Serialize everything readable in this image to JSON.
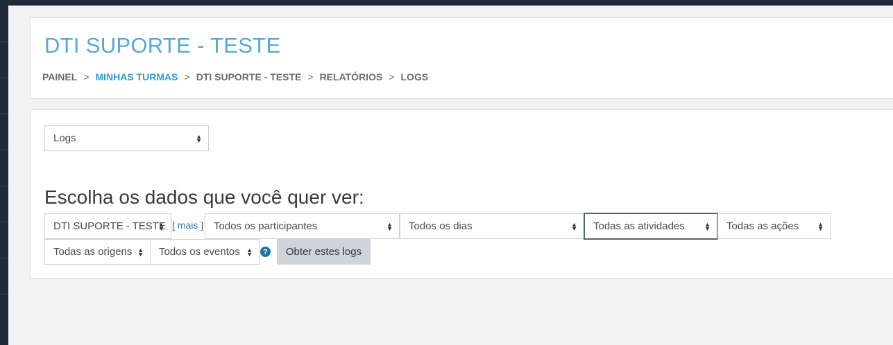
{
  "course": {
    "title": "DTI SUPORTE - TESTE"
  },
  "breadcrumb": [
    {
      "label": "PAINEL",
      "link": false
    },
    {
      "label": "MINHAS TURMAS",
      "link": true
    },
    {
      "label": "DTI SUPORTE - TESTE",
      "link": false
    },
    {
      "label": "RELATÓRIOS",
      "link": false
    },
    {
      "label": "LOGS",
      "link": false
    }
  ],
  "breadcrumb_separator": ">",
  "report_selector": {
    "value": "Logs"
  },
  "filters": {
    "heading": "Escolha os dados que você quer ver:",
    "course_select": "DTI SUPORTE - TESTE",
    "more_link_open": "[",
    "more_link": "mais",
    "more_link_close": "]",
    "participants_select": "Todos os participantes",
    "days_select": "Todos os dias",
    "activities_select": "Todas as atividades",
    "actions_select": "Todas as ações",
    "origins_select": "Todas as origens",
    "events_select": "Todos os eventos",
    "help_icon_glyph": "?",
    "submit_label": "Obter estes logs"
  },
  "colors": {
    "title": "#55a8d4",
    "link": "#2e9bd0",
    "focus_border": "#4f6478",
    "button_bg": "#ced4da",
    "help_icon": "#1677a0",
    "frame": "#1d2a38"
  }
}
